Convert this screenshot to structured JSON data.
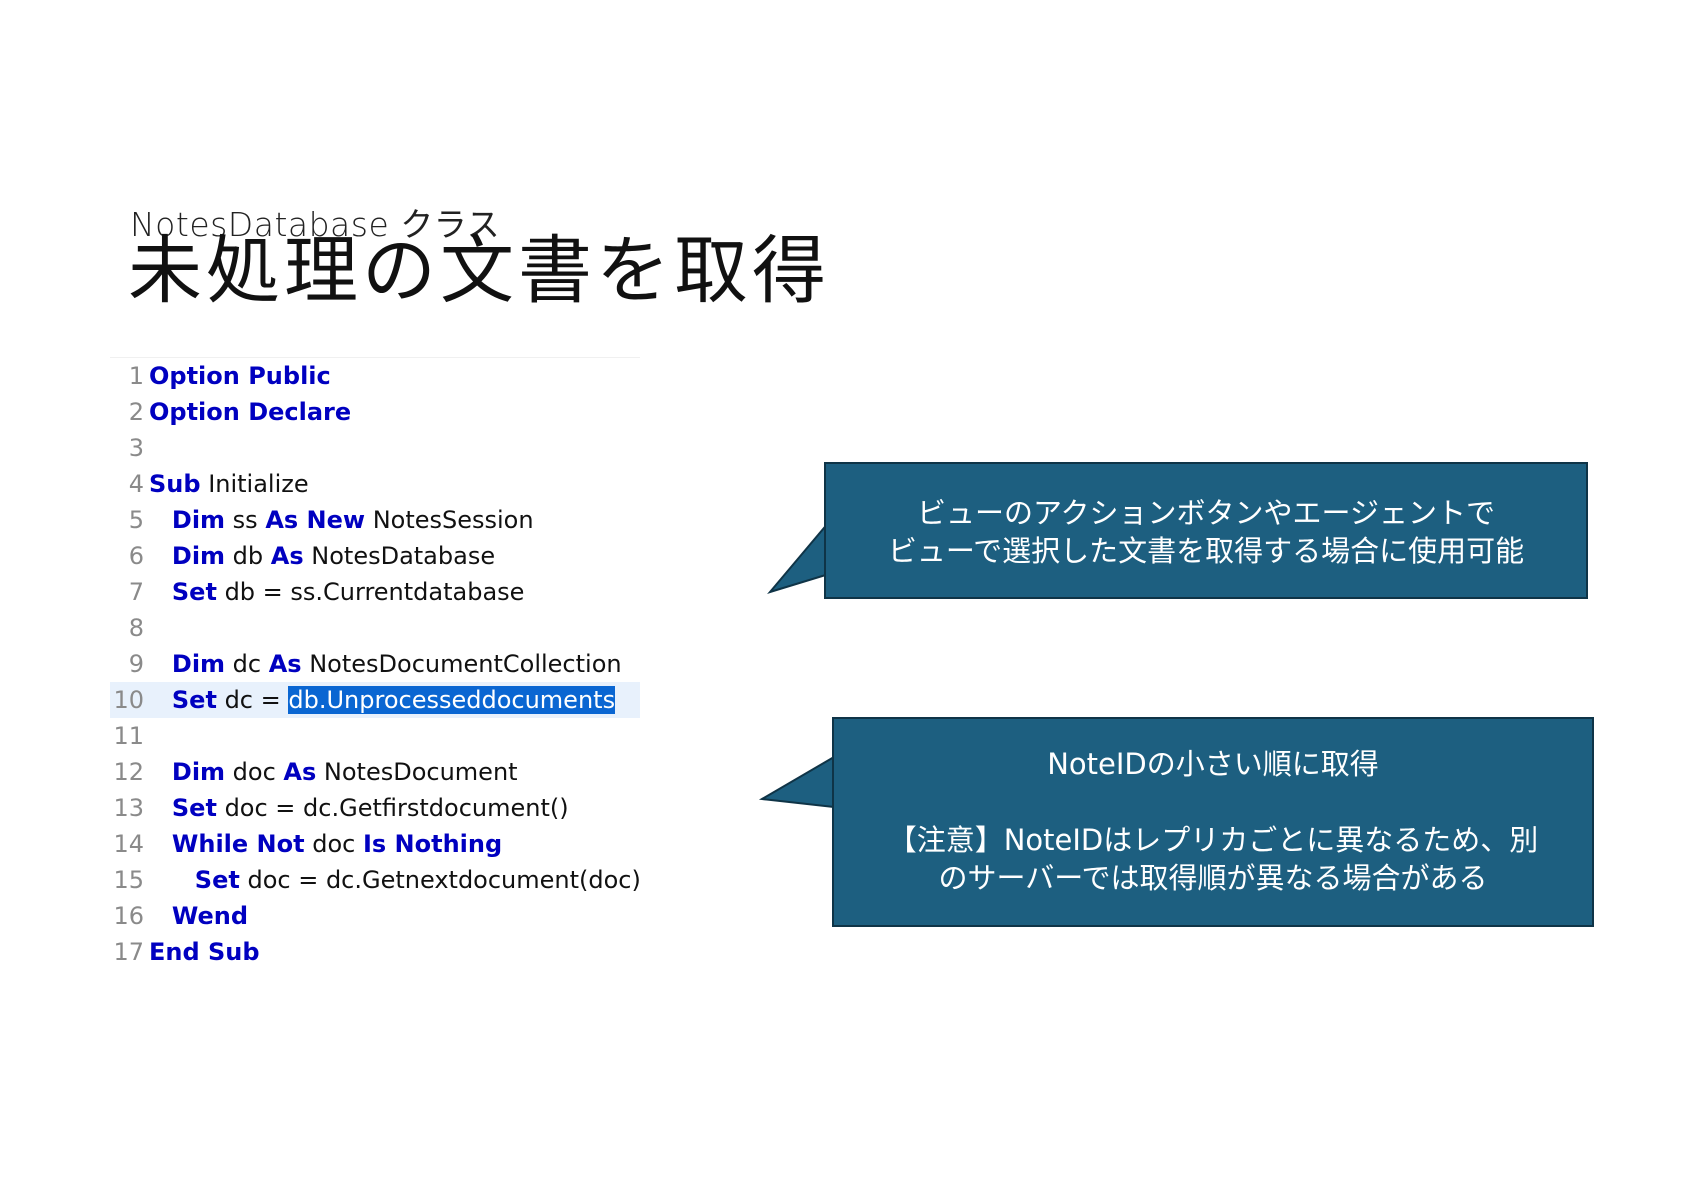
{
  "header": {
    "subtitle": "NotesDatabase クラス",
    "title": "未処理の文書を取得"
  },
  "code": {
    "lines": [
      {
        "no": "1",
        "indent": "",
        "tokens": [
          {
            "t": "Option Public",
            "kw": true
          }
        ]
      },
      {
        "no": "2",
        "indent": "",
        "tokens": [
          {
            "t": "Option Declare",
            "kw": true
          }
        ]
      },
      {
        "no": "3",
        "indent": "",
        "tokens": []
      },
      {
        "no": "4",
        "indent": "",
        "tokens": [
          {
            "t": "Sub",
            "kw": true
          },
          {
            "t": " Initialize"
          }
        ]
      },
      {
        "no": "5",
        "indent": "   ",
        "tokens": [
          {
            "t": "Dim",
            "kw": true
          },
          {
            "t": " ss "
          },
          {
            "t": "As New",
            "kw": true
          },
          {
            "t": " NotesSession"
          }
        ]
      },
      {
        "no": "6",
        "indent": "   ",
        "tokens": [
          {
            "t": "Dim",
            "kw": true
          },
          {
            "t": " db "
          },
          {
            "t": "As",
            "kw": true
          },
          {
            "t": " NotesDatabase"
          }
        ]
      },
      {
        "no": "7",
        "indent": "   ",
        "tokens": [
          {
            "t": "Set",
            "kw": true
          },
          {
            "t": " db = ss.Currentdatabase"
          }
        ]
      },
      {
        "no": "8",
        "indent": "",
        "tokens": []
      },
      {
        "no": "9",
        "indent": "   ",
        "tokens": [
          {
            "t": "Dim",
            "kw": true
          },
          {
            "t": " dc "
          },
          {
            "t": "As",
            "kw": true
          },
          {
            "t": " NotesDocumentCollection"
          }
        ]
      },
      {
        "no": "10",
        "indent": "   ",
        "current": true,
        "tokens": [
          {
            "t": "Set",
            "kw": true
          },
          {
            "t": " dc = "
          },
          {
            "t": "db.Unprocesseddocuments",
            "sel": true
          }
        ]
      },
      {
        "no": "11",
        "indent": "",
        "tokens": []
      },
      {
        "no": "12",
        "indent": "   ",
        "tokens": [
          {
            "t": "Dim",
            "kw": true
          },
          {
            "t": " doc "
          },
          {
            "t": "As",
            "kw": true
          },
          {
            "t": " NotesDocument"
          }
        ]
      },
      {
        "no": "13",
        "indent": "   ",
        "tokens": [
          {
            "t": "Set",
            "kw": true
          },
          {
            "t": " doc = dc.Getfirstdocument()"
          }
        ]
      },
      {
        "no": "14",
        "indent": "   ",
        "tokens": [
          {
            "t": "While Not",
            "kw": true
          },
          {
            "t": " doc "
          },
          {
            "t": "Is Nothing",
            "kw": true
          }
        ]
      },
      {
        "no": "15",
        "indent": "      ",
        "tokens": [
          {
            "t": "Set",
            "kw": true
          },
          {
            "t": " doc = dc.Getnextdocument(doc)"
          }
        ]
      },
      {
        "no": "16",
        "indent": "   ",
        "tokens": [
          {
            "t": "Wend",
            "kw": true
          }
        ]
      },
      {
        "no": "17",
        "indent": "",
        "tokens": [
          {
            "t": "End Sub",
            "kw": true
          }
        ]
      }
    ]
  },
  "callouts": {
    "first": {
      "line1": "ビューのアクションボタンやエージェントで",
      "line2": "ビューで選択した文書を取得する場合に使用可能"
    },
    "second": {
      "line1": "NoteIDの小さい順に取得",
      "line2": "【注意】NoteIDはレプリカごとに異なるため、別",
      "line3": "のサーバーでは取得順が異なる場合がある"
    },
    "color": "#1d5f80",
    "border_color": "#0f3447"
  }
}
